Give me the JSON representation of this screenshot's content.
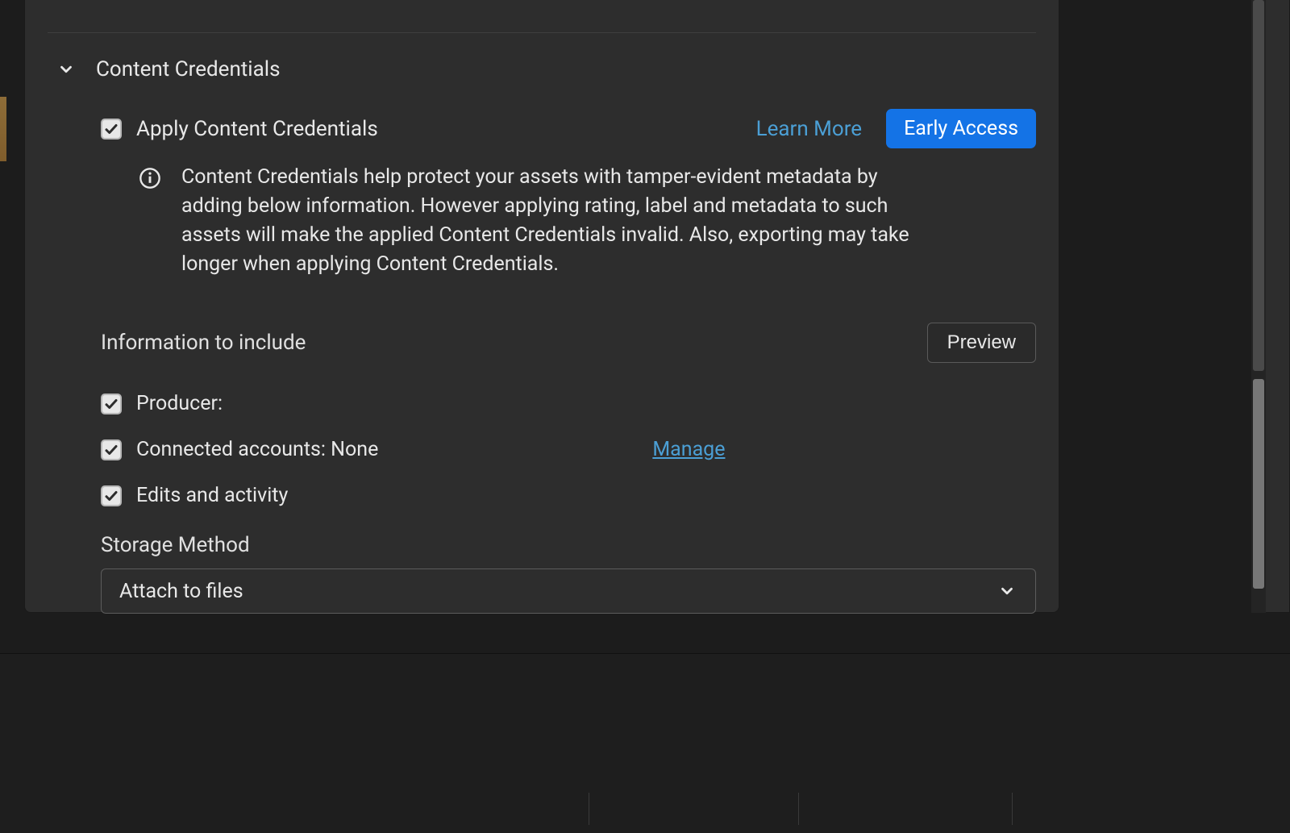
{
  "section": {
    "title": "Content Credentials",
    "apply_label": "Apply Content Credentials",
    "learn_more": "Learn More",
    "early_access": "Early Access",
    "info_text": "Content Credentials help protect your assets with tamper-evident metadata by adding below information. However applying rating, label and metadata to such assets will make the applied Content Credentials invalid. Also, exporting may take longer when applying Content Credentials.",
    "include_title": "Information to include",
    "preview_label": "Preview",
    "items": [
      {
        "label": "Producer:"
      },
      {
        "label": "Connected accounts: None",
        "manage": "Manage"
      },
      {
        "label": "Edits and activity"
      }
    ],
    "storage_label": "Storage Method",
    "storage_value": "Attach to files"
  }
}
